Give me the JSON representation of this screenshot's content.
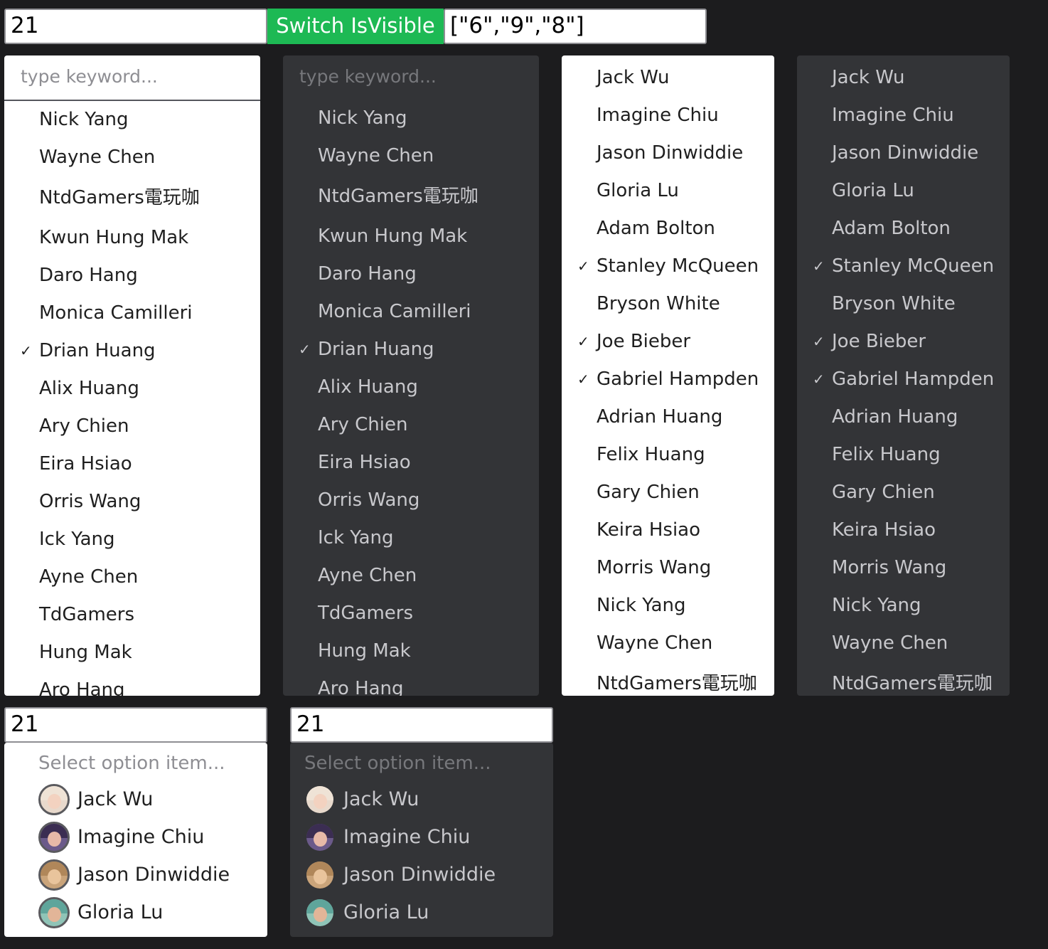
{
  "toolbar": {
    "number_value": "21",
    "switch_label": "Switch IsVisible",
    "selection_value": "[\"6\",\"9\",\"8\"]"
  },
  "search_placeholder": "type keyword...",
  "list_a": {
    "items": [
      {
        "label": "Nick Yang",
        "checked": false
      },
      {
        "label": "Wayne Chen",
        "checked": false
      },
      {
        "label": "NtdGamers電玩咖",
        "checked": false
      },
      {
        "label": "Kwun Hung Mak",
        "checked": false
      },
      {
        "label": "Daro Hang",
        "checked": false
      },
      {
        "label": "Monica Camilleri",
        "checked": false
      },
      {
        "label": "Drian Huang",
        "checked": true
      },
      {
        "label": "Alix Huang",
        "checked": false
      },
      {
        "label": "Ary Chien",
        "checked": false
      },
      {
        "label": "Eira Hsiao",
        "checked": false
      },
      {
        "label": "Orris Wang",
        "checked": false
      },
      {
        "label": "Ick Yang",
        "checked": false
      },
      {
        "label": "Ayne Chen",
        "checked": false
      },
      {
        "label": "TdGamers",
        "checked": false
      },
      {
        "label": "Hung Mak",
        "checked": false
      },
      {
        "label": "Aro Hang",
        "checked": false
      }
    ]
  },
  "list_b": {
    "items": [
      {
        "label": "Jack Wu",
        "checked": false
      },
      {
        "label": "Imagine Chiu",
        "checked": false
      },
      {
        "label": "Jason Dinwiddie",
        "checked": false
      },
      {
        "label": "Gloria Lu",
        "checked": false
      },
      {
        "label": "Adam Bolton",
        "checked": false
      },
      {
        "label": "Stanley McQueen",
        "checked": true
      },
      {
        "label": "Bryson White",
        "checked": false
      },
      {
        "label": "Joe Bieber",
        "checked": true
      },
      {
        "label": "Gabriel Hampden",
        "checked": true
      },
      {
        "label": "Adrian Huang",
        "checked": false
      },
      {
        "label": "Felix Huang",
        "checked": false
      },
      {
        "label": "Gary Chien",
        "checked": false
      },
      {
        "label": "Keira Hsiao",
        "checked": false
      },
      {
        "label": "Morris Wang",
        "checked": false
      },
      {
        "label": "Nick Yang",
        "checked": false
      },
      {
        "label": "Wayne Chen",
        "checked": false
      },
      {
        "label": "NtdGamers電玩咖",
        "checked": false
      }
    ]
  },
  "check_glyph": "✓",
  "bottom": {
    "input_value": "21",
    "placeholder": "Select option item...",
    "options": [
      {
        "label": "Jack Wu",
        "avatar": "avatar-jack-wu-icon"
      },
      {
        "label": "Imagine Chiu",
        "avatar": "avatar-imagine-chiu-icon"
      },
      {
        "label": "Jason Dinwiddie",
        "avatar": "avatar-jason-dinwiddie-icon"
      },
      {
        "label": "Gloria Lu",
        "avatar": "avatar-gloria-lu-icon"
      }
    ]
  },
  "colors": {
    "page_bg": "#1c1c1e",
    "light_panel": "#ffffff",
    "dark_panel": "#333437",
    "switch_button": "#1db954"
  }
}
